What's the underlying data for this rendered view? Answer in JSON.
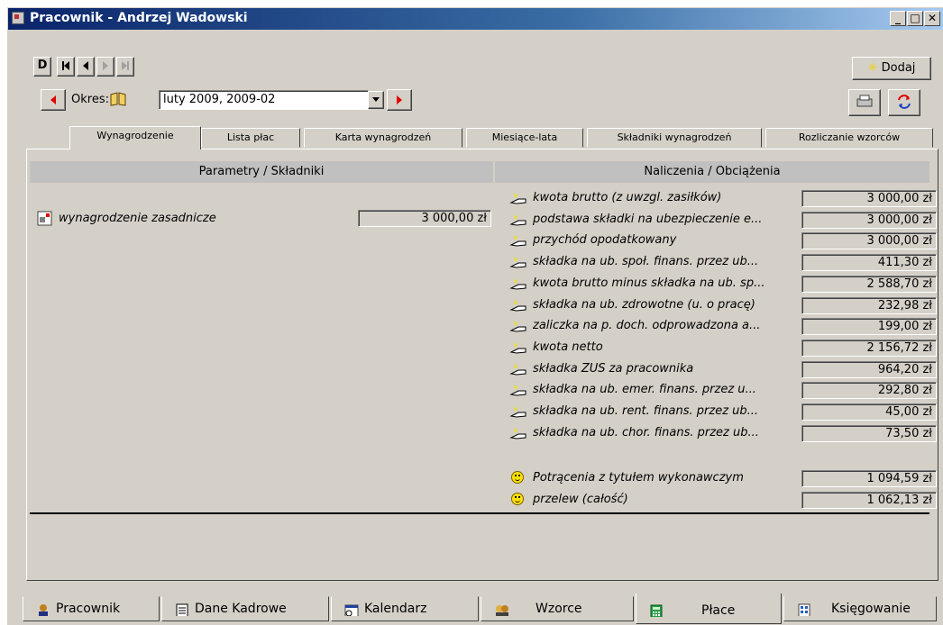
{
  "window": {
    "title": "Pracownik - Andrzej Wadowski"
  },
  "toolbar": {
    "add_label": "Dodaj"
  },
  "period": {
    "label": "Okres:",
    "value": "luty 2009, 2009-02"
  },
  "tabs": [
    {
      "label": "Wynagrodzenie",
      "active": true
    },
    {
      "label": "Lista płac",
      "active": false
    },
    {
      "label": "Karta wynagrodzeń",
      "active": false
    },
    {
      "label": "Miesiące-lata",
      "active": false
    },
    {
      "label": "Składniki wynagrodzeń",
      "active": false
    },
    {
      "label": "Rozliczanie wzorców",
      "active": false
    }
  ],
  "left_panel": {
    "header": "Parametry / Składniki",
    "items": [
      {
        "label": "wynagrodzenie zasadnicze",
        "value": "3 000,00 zł"
      }
    ]
  },
  "right_panel": {
    "header": "Naliczenia / Obciążenia",
    "items": [
      {
        "label": "kwota brutto (z uwzgl. zasiłków)",
        "value": "3 000,00 zł"
      },
      {
        "label": "podstawa składki na ubezpieczenie e...",
        "value": "3 000,00 zł"
      },
      {
        "label": "przychód opodatkowany",
        "value": "3 000,00 zł"
      },
      {
        "label": "składka na ub. społ. finans. przez ub...",
        "value": "411,30 zł"
      },
      {
        "label": "kwota brutto minus składka na ub. sp...",
        "value": "2 588,70 zł"
      },
      {
        "label": "składka na ub. zdrowotne (u. o pracę)",
        "value": "232,98 zł"
      },
      {
        "label": "zaliczka na p. doch. odprowadzona a...",
        "value": "199,00 zł"
      },
      {
        "label": "kwota netto",
        "value": "2 156,72 zł"
      },
      {
        "label": "składka ZUS za pracownika",
        "value": "964,20 zł"
      },
      {
        "label": "składka na ub. emer. finans. przez u...",
        "value": "292,80 zł"
      },
      {
        "label": "składka na ub. rent. finans. przez ub...",
        "value": "45,00 zł"
      },
      {
        "label": "składka na ub. chor. finans. przez ub...",
        "value": "73,50 zł"
      }
    ],
    "totals": [
      {
        "label": "Potrącenia z tytułem wykonawczym",
        "value": "1 094,59 zł"
      },
      {
        "label": "przelew (całość)",
        "value": "1 062,13 zł"
      }
    ]
  },
  "bottom_tabs": [
    {
      "label": "Pracownik",
      "icon": "person-icon",
      "active": false
    },
    {
      "label": "Dane Kadrowe",
      "icon": "document-icon",
      "active": false
    },
    {
      "label": "Kalendarz",
      "icon": "calendar-icon",
      "active": false
    },
    {
      "label": "Wzorce",
      "icon": "people-icon",
      "active": false
    },
    {
      "label": "Płace",
      "icon": "calculator-icon",
      "active": true
    },
    {
      "label": "Księgowanie",
      "icon": "ledger-icon",
      "active": false
    }
  ],
  "colors": {
    "title_start": "#0a246a",
    "title_end": "#a6caf0",
    "face": "#d4d0c8",
    "arrow_red": "#e00000"
  }
}
